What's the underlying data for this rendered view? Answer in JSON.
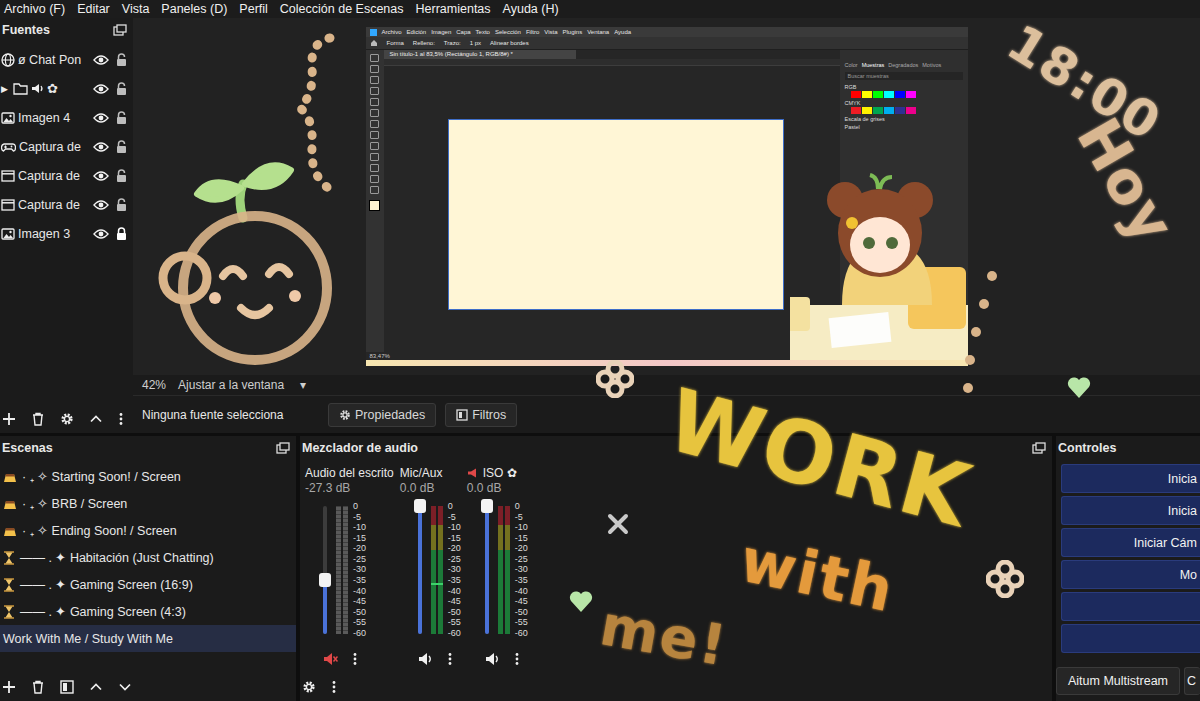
{
  "menu": [
    "Archivo (F)",
    "Editar",
    "Vista",
    "Paneles (D)",
    "Perfil",
    "Colección de Escenas",
    "Herramientas",
    "Ayuda (H)"
  ],
  "sources": {
    "title": "Fuentes",
    "items": [
      {
        "label": "ø Chat Pon",
        "kind": "browser",
        "visible": true,
        "locked": false
      },
      {
        "label": "✿",
        "kind": "group",
        "toggle": "▶",
        "expanded": false,
        "visible": true,
        "locked": false
      },
      {
        "label": "Imagen 4",
        "kind": "image",
        "visible": true,
        "locked": false
      },
      {
        "label": "Captura de",
        "kind": "game",
        "visible": true,
        "locked": false
      },
      {
        "label": "Captura de",
        "kind": "window",
        "visible": true,
        "locked": false
      },
      {
        "label": "Captura de",
        "kind": "window",
        "visible": true,
        "locked": false
      },
      {
        "label": "Imagen 3",
        "kind": "image",
        "visible": true,
        "locked": true
      }
    ]
  },
  "preview": {
    "zoom": "42%",
    "fit": "Ajustar a la ventana",
    "fit_arrow": "▾",
    "no_source": "Ninguna fuente selecciona",
    "buttons": [
      {
        "label": "Propiedades",
        "kind": "gear"
      },
      {
        "label": "Filtros",
        "kind": "filter"
      }
    ]
  },
  "captured_window": {
    "menu": [
      "Archivo",
      "Edición",
      "Imagen",
      "Capa",
      "Texto",
      "Selección",
      "Filtro",
      "Vista",
      "Plugins",
      "Ventana",
      "Ayuda"
    ],
    "options": [
      "Forma",
      "Relleno:",
      "Trazo:",
      "1 px",
      "Alinear bordes"
    ],
    "tab": "Sin título-1 al 83,5% (Rectángulo 1, RGB/8#) *",
    "panel_tabs": [
      {
        "label": "Color",
        "selected": false
      },
      {
        "label": "Muestras",
        "selected": true
      },
      {
        "label": "Degradados",
        "selected": false
      },
      {
        "label": "Motivos",
        "selected": false
      }
    ],
    "search": "Buscar muestras",
    "swatch_groups": [
      {
        "name": "RGB",
        "colors": [
          "#ff0000",
          "#ffff00",
          "#00ff00",
          "#00ffff",
          "#0000ff",
          "#ff00ff"
        ]
      },
      {
        "name": "CMYK",
        "colors": [
          "#ed1c24",
          "#fff200",
          "#00a651",
          "#00aeef",
          "#2e3192",
          "#ec008c"
        ]
      },
      {
        "name": "Escala de grises",
        "colors": []
      },
      {
        "name": "Pastel",
        "colors": []
      }
    ],
    "status": "83,47%"
  },
  "scenes": {
    "title": "Escenas",
    "items": [
      {
        "label": "· ₊ ✧ Starting Soon! / Screen",
        "kind": "pudding",
        "selected": false
      },
      {
        "label": "· ₊ ✧ BRB /  Screen",
        "kind": "pudding",
        "selected": false
      },
      {
        "label": "· ₊ ✧ Ending Soon! / Screen",
        "kind": "pudding",
        "selected": false
      },
      {
        "label": "—— . ✦ Habitación (Just Chatting)",
        "kind": "hourglass",
        "selected": false
      },
      {
        "label": "—— . ✦ Gaming Screen (16:9)",
        "kind": "hourglass",
        "selected": false
      },
      {
        "label": "—— . ✦ Gaming Screen (4:3)",
        "kind": "hourglass",
        "selected": false
      },
      {
        "label": "Work With Me / Study With Me",
        "kind": "plain",
        "selected": true
      }
    ]
  },
  "mixer": {
    "title": "Mezclador de audio",
    "scale": [
      "0",
      "-5",
      "-10",
      "-15",
      "-20",
      "-25",
      "-30",
      "-35",
      "-40",
      "-45",
      "-50",
      "-55",
      "-60"
    ],
    "channels": [
      {
        "name": "Audio del escrito",
        "reading": "-27.3 dB",
        "level": 0.42,
        "muted": true,
        "peak": 0,
        "kind": "plain"
      },
      {
        "name": "Mic/Aux",
        "reading": "0.0 dB",
        "level": 1,
        "muted": false,
        "peak": 0.38,
        "kind": "plain"
      },
      {
        "name": "ISO",
        "suffix": "✿",
        "reading": "0.0 dB",
        "level": 1,
        "muted": false,
        "peak": 0,
        "kind": "source"
      }
    ]
  },
  "controls": {
    "title": "Controles",
    "buttons": [
      "Inicia",
      "Inicia",
      "Iniciar Cám",
      "Mo",
      "",
      ""
    ],
    "footer": [
      "Aitum Multistream",
      "C"
    ]
  },
  "overlay": {
    "words": [
      {
        "text": "18:00",
        "color": "#dcbf9c"
      },
      {
        "text": "Hoy",
        "color": "#d8b690"
      },
      {
        "text": "WORK",
        "color": "#e7c43e"
      },
      {
        "text": "with",
        "color": "#e49a3c"
      },
      {
        "text": "me!",
        "color": "#b7843e"
      }
    ]
  }
}
